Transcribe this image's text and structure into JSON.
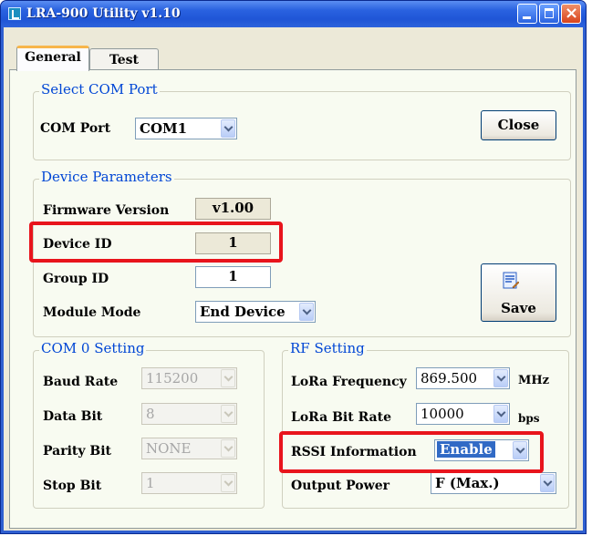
{
  "window": {
    "title": "LRA-900 Utility v1.10"
  },
  "tabs": [
    {
      "label": "General"
    },
    {
      "label": "Test"
    }
  ],
  "select_com_port": {
    "title": "Select COM Port",
    "com_port_label": "COM Port",
    "com_port_value": "COM1",
    "close_label": "Close"
  },
  "device_parameters": {
    "title": "Device Parameters",
    "firmware_label": "Firmware Version",
    "firmware_value": "v1.00",
    "device_id_label": "Device ID",
    "device_id_value": "1",
    "group_id_label": "Group ID",
    "group_id_value": "1",
    "module_mode_label": "Module Mode",
    "module_mode_value": "End Device",
    "save_label": "Save"
  },
  "com0_setting": {
    "title": "COM 0 Setting",
    "baud_rate_label": "Baud Rate",
    "baud_rate_value": "115200",
    "data_bit_label": "Data Bit",
    "data_bit_value": "8",
    "parity_bit_label": "Parity Bit",
    "parity_bit_value": "NONE",
    "stop_bit_label": "Stop Bit",
    "stop_bit_value": "1"
  },
  "rf_setting": {
    "title": "RF Setting",
    "lora_frequency_label": "LoRa Frequency",
    "lora_frequency_value": "869.500",
    "lora_frequency_unit": "MHz",
    "lora_bitrate_label": "LoRa Bit Rate",
    "lora_bitrate_value": "10000",
    "lora_bitrate_unit": "bps",
    "rssi_label": "RSSI Information",
    "rssi_value": "Enable",
    "output_power_label": "Output Power",
    "output_power_value": "F (Max.)"
  },
  "colors": {
    "highlight": "#e8141c",
    "titlebar": "#2a62e0",
    "group_title": "#0046d5",
    "tab_accent": "#f7b64b"
  }
}
